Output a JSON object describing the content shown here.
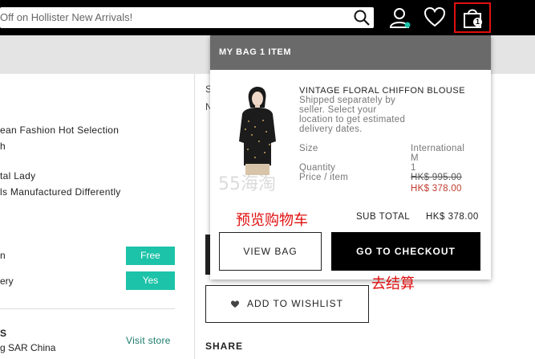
{
  "header": {
    "search_text": "Off on Hollister New Arrivals!",
    "bag_count": "1"
  },
  "left": {
    "features": [
      "ean Fashion Hot Selection",
      "h",
      "tal Lady",
      "ls Manufactured Differently"
    ],
    "options": [
      {
        "label": "n",
        "value": "Free"
      },
      {
        "label": "ery",
        "value": "Yes"
      }
    ],
    "store_title": "S",
    "store_location": "g SAR China",
    "visit_store": "Visit store"
  },
  "middle": {
    "s_char": "S",
    "n_char": "N",
    "wishlist": "ADD TO WISHLIST",
    "share": "SHARE"
  },
  "bag": {
    "header": "MY BAG 1 ITEM",
    "product_name": "VINTAGE FLORAL CHIFFON BLOUSE",
    "shipping_note": "Shipped separately by seller. Select your location to get estimated delivery dates.",
    "size_label": "Size",
    "size_value_1": "International",
    "size_value_2": "M",
    "quantity_label": "Quantity",
    "quantity_value": "1",
    "price_label": "Price / item",
    "original_price": "HK$ 995.00",
    "sale_price": "HK$ 378.00",
    "subtotal_label": "SUB TOTAL",
    "subtotal_value": "HK$ 378.00",
    "view_bag": "VIEW BAG",
    "checkout": "GO TO CHECKOUT"
  },
  "annotations": {
    "preview_cart": "预览购物车",
    "checkout": "去结算",
    "watermark": "55海淘"
  },
  "colors": {
    "accent_green": "#1cc3a8",
    "annotation_red": "#e01010",
    "sale_red": "#c0392b"
  }
}
